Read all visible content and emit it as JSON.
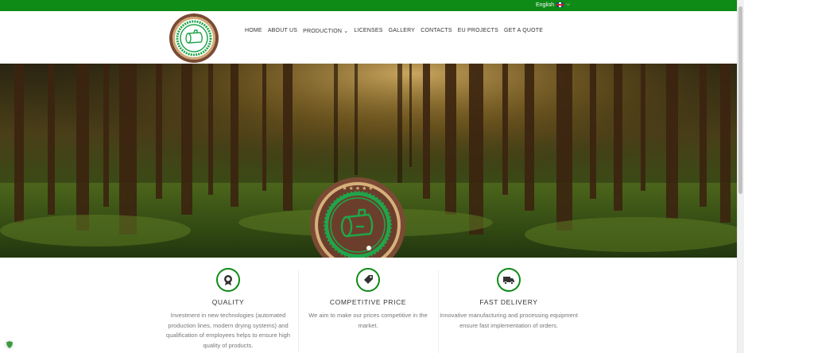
{
  "topbar": {
    "language": "English",
    "language_flag_icon": "uk-flag-icon",
    "language_chevron_icon": "chevron-down-icon",
    "bg_color": "#0e8a16"
  },
  "header": {
    "logo_icon": "log-badge-logo",
    "nav": [
      {
        "label": "HOME"
      },
      {
        "label": "ABOUT US"
      },
      {
        "label": "PRODUCTION",
        "has_dropdown": true
      },
      {
        "label": "LICENSES"
      },
      {
        "label": "GALLERY"
      },
      {
        "label": "CONTACTS"
      },
      {
        "label": "EU PROJECTS"
      },
      {
        "label": "GET A QUOTE"
      }
    ]
  },
  "hero": {
    "background": "forest-photo",
    "center_icon": "log-badge-logo",
    "slides_count": 1,
    "active_slide": 1
  },
  "features": [
    {
      "icon": "medal-icon",
      "title": "QUALITY",
      "text": "Investment in new technologies (automated production lines, modern drying systems) and qualification of employees helps to ensure high quality of products."
    },
    {
      "icon": "price-tag-icon",
      "title": "COMPETITIVE PRICE",
      "text": "We aim to make our prices competitive in the market."
    },
    {
      "icon": "delivery-truck-icon",
      "title": "FAST DELIVERY",
      "text": "Innovative manufacturing and processing equipment ensure fast implementation of orders."
    }
  ],
  "accent_color": "#0e8a16"
}
